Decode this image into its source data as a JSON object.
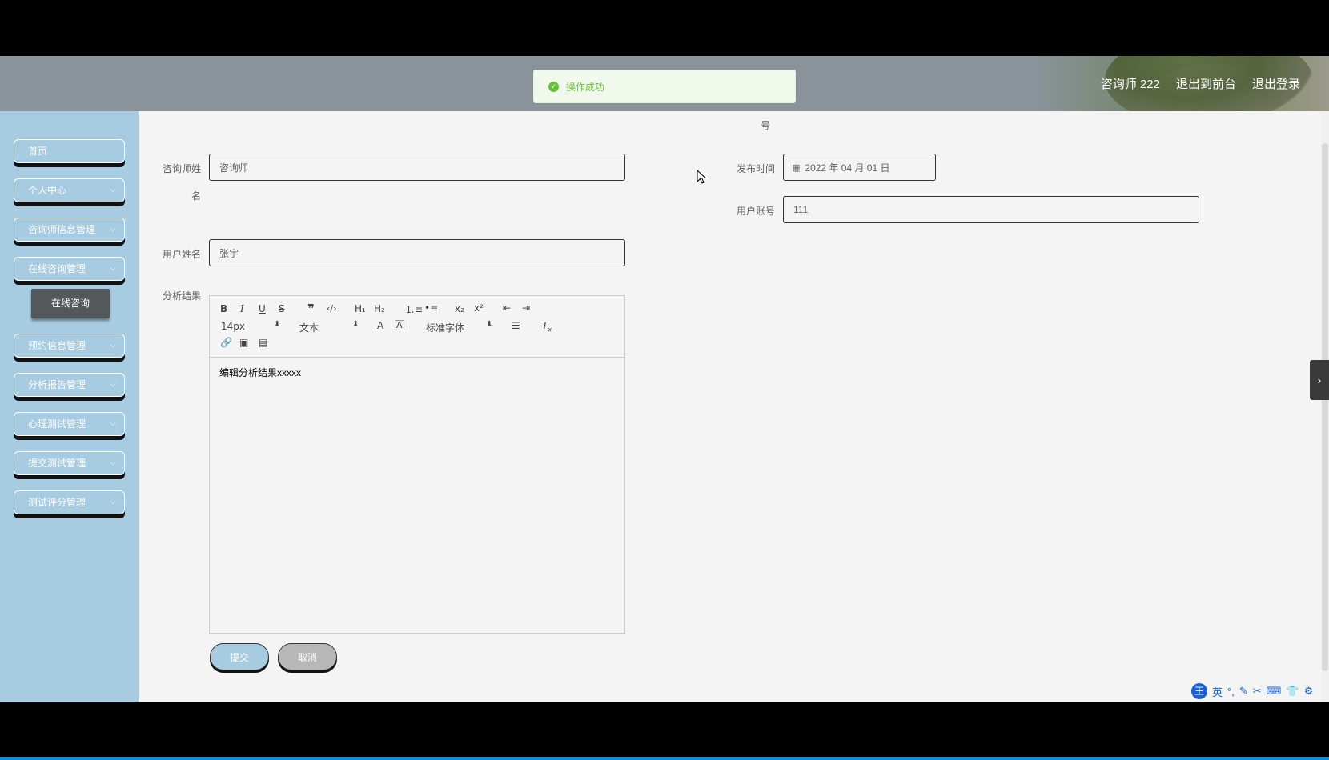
{
  "header": {
    "user": "咨询师 222",
    "link_front": "退出到前台",
    "link_logout": "退出登录"
  },
  "toast": {
    "message": "操作成功"
  },
  "sidebar": {
    "items": [
      {
        "label": "首页"
      },
      {
        "label": "个人中心"
      },
      {
        "label": "咨询师信息管理"
      },
      {
        "label": "在线咨询管理"
      },
      {
        "label": "预约信息管理"
      },
      {
        "label": "分析报告管理"
      },
      {
        "label": "心理测试管理"
      },
      {
        "label": "提交测试管理"
      },
      {
        "label": "测试评分管理"
      }
    ],
    "submenu_label": "在线咨询"
  },
  "form": {
    "top_fragment": "号",
    "counselor_name_label_1": "咨询师姓",
    "counselor_name_label_2": "名",
    "counselor_name_value": "咨询师",
    "publish_time_label": "发布时间",
    "publish_time_value": "2022 年 04 月 01 日",
    "user_account_label": "用户账号",
    "user_account_value": "111",
    "user_name_label": "用户姓名",
    "user_name_value": "张宇",
    "result_label": "分析结果",
    "editor_content": "编辑分析结果xxxxx",
    "toolbar": {
      "font_size": "14px",
      "format": "文本",
      "font_family": "标准字体"
    },
    "submit_label": "提交",
    "cancel_label": "取消"
  },
  "ime": {
    "lang": "英"
  },
  "colors": {
    "sidebar": "#a7cbe0",
    "submit": "#a7cbe0",
    "cancel": "#b8b8b8",
    "toast_text": "#67c23a",
    "submenu": "#55585a"
  }
}
